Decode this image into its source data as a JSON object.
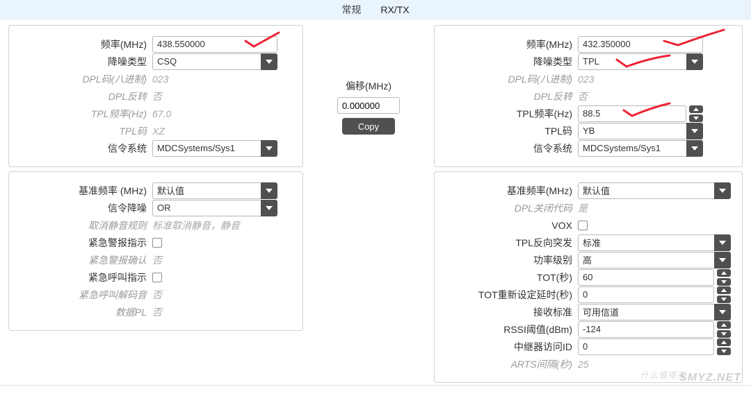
{
  "tabs": {
    "general": "常规",
    "rxtx": "RX/TX"
  },
  "offset": {
    "label": "偏移(MHz)",
    "value": "0.000000",
    "copy": "Copy"
  },
  "left": {
    "freq_label": "频率(MHz)",
    "freq_value": "438.550000",
    "sq_label": "降噪类型",
    "sq_value": "CSQ",
    "dpl_code_label": "DPL码(八进制)",
    "dpl_code_value": "023",
    "dpl_inv_label": "DPL反转",
    "dpl_inv_value": "否",
    "tpl_freq_label": "TPL频率(Hz)",
    "tpl_freq_value": "67.0",
    "tpl_code_label": "TPL码",
    "tpl_code_value": "XZ",
    "signal_label": "信令系统",
    "signal_value": "MDCSystems/Sys1",
    "base_freq_label": "基准频率 (MHz)",
    "base_freq_value": "默认值",
    "sig_sq_label": "信令降噪",
    "sig_sq_value": "OR",
    "unmute_label": "取消静音规则",
    "unmute_value": "标准取消静音，静音",
    "alarm_ind_label": "紧急警报指示",
    "alarm_ack_label": "紧急警报确认",
    "alarm_ack_value": "否",
    "call_ind_label": "紧急呼叫指示",
    "call_dec_label": "紧急呼叫解码音",
    "call_dec_value": "否",
    "data_pl_label": "数据PL",
    "data_pl_value": "否"
  },
  "right": {
    "freq_label": "频率(MHz)",
    "freq_value": "432.350000",
    "sq_label": "降噪类型",
    "sq_value": "TPL",
    "dpl_code_label": "DPL码(八进制)",
    "dpl_code_value": "023",
    "dpl_inv_label": "DPL反转",
    "dpl_inv_value": "否",
    "tpl_freq_label": "TPL频率(Hz)",
    "tpl_freq_value": "88.5",
    "tpl_code_label": "TPL码",
    "tpl_code_value": "YB",
    "signal_label": "信令系统",
    "signal_value": "MDCSystems/Sys1",
    "base_freq_label": "基准频率(MHz)",
    "base_freq_value": "默认值",
    "dpl_close_label": "DPL关闭代码",
    "dpl_close_value": "是",
    "vox_label": "VOX",
    "tpl_rev_label": "TPL反向突发",
    "tpl_rev_value": "标准",
    "power_label": "功率级别",
    "power_value": "高",
    "tot_label": "TOT(秒)",
    "tot_value": "60",
    "tot_reset_label": "TOT重新设定延时(秒)",
    "tot_reset_value": "0",
    "rx_std_label": "接收标准",
    "rx_std_value": "可用信道",
    "rssi_label": "RSSI阈值(dBm)",
    "rssi_value": "-124",
    "rep_id_label": "中继器访问ID",
    "rep_id_value": "0",
    "arts_label": "ARTS间隔(秒)",
    "arts_value": "25"
  },
  "watermark": {
    "brand": "SMYZ.NET",
    "zh": "什么值得买"
  }
}
